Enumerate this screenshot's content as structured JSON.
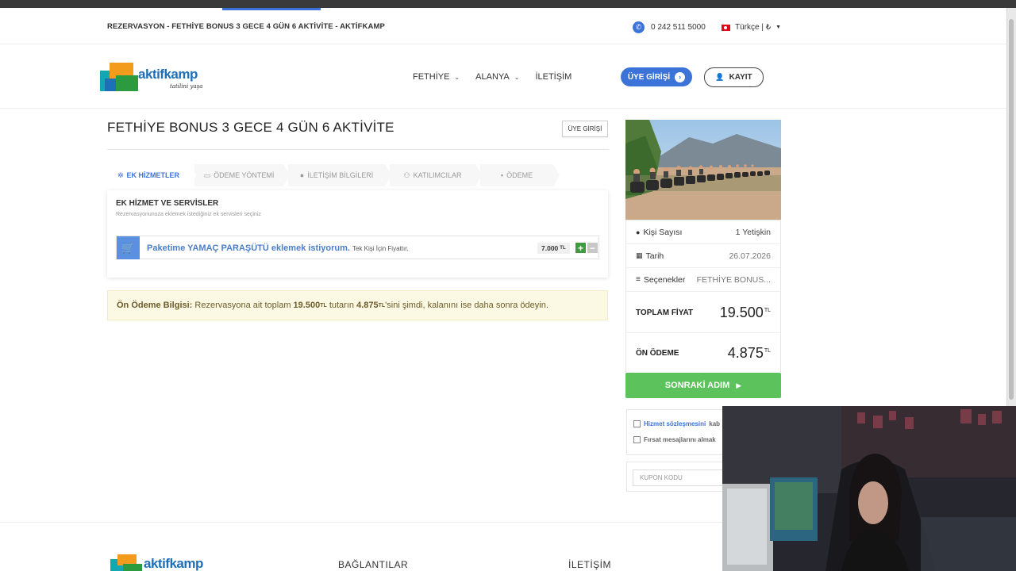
{
  "topbar": {
    "breadcrumb": "REZERVASYON - FETHİYE BONUS 3 GECE 4 GÜN 6 AKTİVİTE - AKTİFKAMP",
    "phone": "0 242 511 5000",
    "language": "Türkçe | ₺"
  },
  "header": {
    "logo_text": "aktifkamp",
    "logo_tagline": "tatilini yaşa",
    "nav": [
      {
        "label": "FETHİYE"
      },
      {
        "label": "ALANYA"
      },
      {
        "label": "İLETİŞİM"
      }
    ],
    "login_label": "ÜYE GİRİŞİ",
    "register_label": "KAYIT"
  },
  "main": {
    "title": "FETHİYE BONUS 3 GECE 4 GÜN 6 AKTİVİTE",
    "member_login_small": "ÜYE GİRİŞİ",
    "steps": [
      {
        "label": "EK HİZMETLER",
        "icon": "spinner-icon"
      },
      {
        "label": "ÖDEME YÖNTEMİ",
        "icon": "credit-card-icon"
      },
      {
        "label": "İLETİŞİM BİLGİLERİ",
        "icon": "user-icon"
      },
      {
        "label": "KATILIMCILAR",
        "icon": "users-icon"
      },
      {
        "label": "ÖDEME",
        "icon": "briefcase-icon"
      }
    ],
    "services": {
      "title": "EK HİZMET VE SERVİSLER",
      "subtitle": "Rezervasyonunuza eklemek istediğiniz ek servisleri seçiniz",
      "item_text": "Paketime YAMAÇ PARAŞÜTÜ eklemek istiyorum.",
      "item_note": "Tek Kişi İçin Fiyattır.",
      "item_price": "7.000",
      "item_currency": "TL"
    },
    "prepay": {
      "label": "Ön Ödeme Bilgisi:",
      "text1": "Rezervasyona ait toplam",
      "total": "19.500",
      "currency": "TL",
      "text2": "tutarın",
      "deposit": "4.875",
      "text3": "'sini şimdi, kalanını ise daha sonra ödeyin."
    }
  },
  "summary": {
    "rows": [
      {
        "label": "Kişi Sayısı",
        "value": "1 Yetişkin",
        "icon": "user-icon"
      },
      {
        "label": "Tarih",
        "value": "26.07.2026",
        "icon": "calendar-icon"
      },
      {
        "label": "Seçenekler",
        "value": "FETHİYE BONUS...",
        "icon": "list-icon"
      }
    ],
    "total_label": "TOPLAM FİYAT",
    "total_value": "19.500",
    "prepay_label": "ÖN ÖDEME",
    "prepay_value": "4.875",
    "currency": "TL",
    "next_label": "SONRAKİ ADIM",
    "terms_link": "Hizmet sözleşmesini",
    "terms_rest": "kab",
    "promo_text": "Fırsat mesajlarını almak",
    "coupon_placeholder": "KUPON KODU"
  },
  "footer": {
    "logo_text": "aktifkamp",
    "links_title": "BAĞLANTILAR",
    "contact_title": "İLETİŞİM"
  },
  "colors": {
    "accent": "#3b73d9",
    "success": "#5cc25c",
    "notice_bg": "#fbf8e3"
  }
}
